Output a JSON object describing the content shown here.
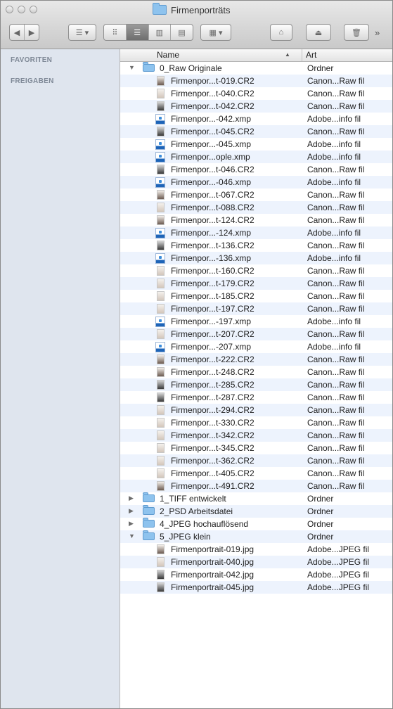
{
  "window": {
    "title": "Firmenporträts"
  },
  "toolbar": {
    "more": "»"
  },
  "sidebar": {
    "sections": [
      "FAVORITEN",
      "FREIGABEN"
    ]
  },
  "columns": {
    "name": "Name",
    "kind": "Art"
  },
  "rows": [
    {
      "level": 0,
      "type": "folder",
      "expanded": true,
      "name": "0_Raw Originale",
      "kind": "Ordner"
    },
    {
      "level": 1,
      "type": "cr2",
      "shade": "dark",
      "name": "Firmenpor...t-019.CR2",
      "kind": "Canon...Raw fil"
    },
    {
      "level": 1,
      "type": "cr2",
      "shade": "light",
      "name": "Firmenpor...t-040.CR2",
      "kind": "Canon...Raw fil"
    },
    {
      "level": 1,
      "type": "cr2",
      "shade": "darker",
      "name": "Firmenpor...t-042.CR2",
      "kind": "Canon...Raw fil"
    },
    {
      "level": 1,
      "type": "xmp",
      "name": "Firmenpor...-042.xmp",
      "kind": "Adobe...info fil"
    },
    {
      "level": 1,
      "type": "cr2",
      "shade": "darker",
      "name": "Firmenpor...t-045.CR2",
      "kind": "Canon...Raw fil"
    },
    {
      "level": 1,
      "type": "xmp",
      "name": "Firmenpor...-045.xmp",
      "kind": "Adobe...info fil"
    },
    {
      "level": 1,
      "type": "xmp",
      "name": "Firmenpor...ople.xmp",
      "kind": "Adobe...info fil"
    },
    {
      "level": 1,
      "type": "cr2",
      "shade": "darker",
      "name": "Firmenpor...t-046.CR2",
      "kind": "Canon...Raw fil"
    },
    {
      "level": 1,
      "type": "xmp",
      "name": "Firmenpor...-046.xmp",
      "kind": "Adobe...info fil"
    },
    {
      "level": 1,
      "type": "cr2",
      "shade": "dark",
      "name": "Firmenpor...t-067.CR2",
      "kind": "Canon...Raw fil"
    },
    {
      "level": 1,
      "type": "cr2",
      "shade": "light",
      "name": "Firmenpor...t-088.CR2",
      "kind": "Canon...Raw fil"
    },
    {
      "level": 1,
      "type": "cr2",
      "shade": "dark",
      "name": "Firmenpor...t-124.CR2",
      "kind": "Canon...Raw fil"
    },
    {
      "level": 1,
      "type": "xmp",
      "name": "Firmenpor...-124.xmp",
      "kind": "Adobe...info fil"
    },
    {
      "level": 1,
      "type": "cr2",
      "shade": "darker",
      "name": "Firmenpor...t-136.CR2",
      "kind": "Canon...Raw fil"
    },
    {
      "level": 1,
      "type": "xmp",
      "name": "Firmenpor...-136.xmp",
      "kind": "Adobe...info fil"
    },
    {
      "level": 1,
      "type": "cr2",
      "shade": "light",
      "name": "Firmenpor...t-160.CR2",
      "kind": "Canon...Raw fil"
    },
    {
      "level": 1,
      "type": "cr2",
      "shade": "light",
      "name": "Firmenpor...t-179.CR2",
      "kind": "Canon...Raw fil"
    },
    {
      "level": 1,
      "type": "cr2",
      "shade": "light",
      "name": "Firmenpor...t-185.CR2",
      "kind": "Canon...Raw fil"
    },
    {
      "level": 1,
      "type": "cr2",
      "shade": "light",
      "name": "Firmenpor...t-197.CR2",
      "kind": "Canon...Raw fil"
    },
    {
      "level": 1,
      "type": "xmp",
      "name": "Firmenpor...-197.xmp",
      "kind": "Adobe...info fil"
    },
    {
      "level": 1,
      "type": "cr2",
      "shade": "light",
      "name": "Firmenpor...t-207.CR2",
      "kind": "Canon...Raw fil"
    },
    {
      "level": 1,
      "type": "xmp",
      "name": "Firmenpor...-207.xmp",
      "kind": "Adobe...info fil"
    },
    {
      "level": 1,
      "type": "cr2",
      "shade": "dark",
      "name": "Firmenpor...t-222.CR2",
      "kind": "Canon...Raw fil"
    },
    {
      "level": 1,
      "type": "cr2",
      "shade": "dark",
      "name": "Firmenpor...t-248.CR2",
      "kind": "Canon...Raw fil"
    },
    {
      "level": 1,
      "type": "cr2",
      "shade": "darker",
      "name": "Firmenpor...t-285.CR2",
      "kind": "Canon...Raw fil"
    },
    {
      "level": 1,
      "type": "cr2",
      "shade": "darker",
      "name": "Firmenpor...t-287.CR2",
      "kind": "Canon...Raw fil"
    },
    {
      "level": 1,
      "type": "cr2",
      "shade": "light",
      "name": "Firmenpor...t-294.CR2",
      "kind": "Canon...Raw fil"
    },
    {
      "level": 1,
      "type": "cr2",
      "shade": "light",
      "name": "Firmenpor...t-330.CR2",
      "kind": "Canon...Raw fil"
    },
    {
      "level": 1,
      "type": "cr2",
      "shade": "light",
      "name": "Firmenpor...t-342.CR2",
      "kind": "Canon...Raw fil"
    },
    {
      "level": 1,
      "type": "cr2",
      "shade": "light",
      "name": "Firmenpor...t-345.CR2",
      "kind": "Canon...Raw fil"
    },
    {
      "level": 1,
      "type": "cr2",
      "shade": "light",
      "name": "Firmenpor...t-362.CR2",
      "kind": "Canon...Raw fil"
    },
    {
      "level": 1,
      "type": "cr2",
      "shade": "light",
      "name": "Firmenpor...t-405.CR2",
      "kind": "Canon...Raw fil"
    },
    {
      "level": 1,
      "type": "cr2",
      "shade": "dark",
      "name": "Firmenpor...t-491.CR2",
      "kind": "Canon...Raw fil"
    },
    {
      "level": 0,
      "type": "folder",
      "expanded": false,
      "name": "1_TIFF entwickelt",
      "kind": "Ordner"
    },
    {
      "level": 0,
      "type": "folder",
      "expanded": false,
      "name": "2_PSD Arbeitsdatei",
      "kind": "Ordner"
    },
    {
      "level": 0,
      "type": "folder",
      "expanded": false,
      "name": "4_JPEG hochauflösend",
      "kind": "Ordner"
    },
    {
      "level": 0,
      "type": "folder",
      "expanded": true,
      "name": "5_JPEG klein",
      "kind": "Ordner"
    },
    {
      "level": 1,
      "type": "jpg",
      "shade": "dark",
      "name": "Firmenportrait-019.jpg",
      "kind": "Adobe...JPEG fil"
    },
    {
      "level": 1,
      "type": "jpg",
      "shade": "light",
      "name": "Firmenportrait-040.jpg",
      "kind": "Adobe...JPEG fil"
    },
    {
      "level": 1,
      "type": "jpg",
      "shade": "darker",
      "name": "Firmenportrait-042.jpg",
      "kind": "Adobe...JPEG fil"
    },
    {
      "level": 1,
      "type": "jpg",
      "shade": "darker",
      "name": "Firmenportrait-045.jpg",
      "kind": "Adobe...JPEG fil"
    }
  ]
}
